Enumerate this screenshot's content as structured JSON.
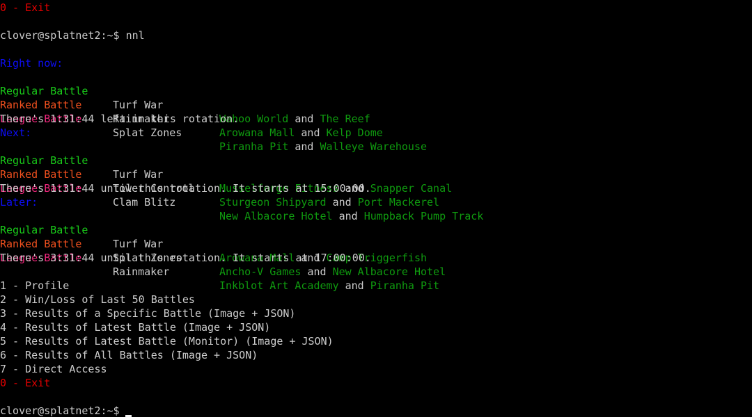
{
  "colors": {
    "background": "#000000",
    "default_text": "#cccccc",
    "exit": "#e70000",
    "section_header": "#0d0df5",
    "regular": "#19cb19",
    "ranked": "#f0501e",
    "league": "#f0287d",
    "stage": "#0f9a0f"
  },
  "top": {
    "exit_line": "0 - Exit",
    "prompt": "clover@splatnet2:~$",
    "command": "nnl"
  },
  "rotations": [
    {
      "header": "Right now:",
      "rows": [
        {
          "type": "Regular Battle",
          "mode": "Turf War",
          "stage1": "Wahoo World",
          "and": "and",
          "stage2": "The Reef"
        },
        {
          "type": "Ranked Battle",
          "mode": "Rainmaker",
          "stage1": "Arowana Mall",
          "and": "and",
          "stage2": "Kelp Dome"
        },
        {
          "type": "League Battle",
          "mode": "Splat Zones",
          "stage1": "Piranha Pit",
          "and": "and",
          "stage2": "Walleye Warehouse"
        }
      ],
      "status": "There's 1:31:44 left in this rotation."
    },
    {
      "header": "Next:",
      "rows": [
        {
          "type": "Regular Battle",
          "mode": "Turf War",
          "stage1": "Musselforge Fitness",
          "and": "and",
          "stage2": "Snapper Canal"
        },
        {
          "type": "Ranked Battle",
          "mode": "Tower Control",
          "stage1": "Sturgeon Shipyard",
          "and": "and",
          "stage2": "Port Mackerel"
        },
        {
          "type": "League Battle",
          "mode": "Clam Blitz",
          "stage1": "New Albacore Hotel",
          "and": "and",
          "stage2": "Humpback Pump Track"
        }
      ],
      "status": "There's 1:31:44 until this rotation. It starts at 15:00:00."
    },
    {
      "header": "Later:",
      "rows": [
        {
          "type": "Regular Battle",
          "mode": "Turf War",
          "stage1": "Arowana Mall",
          "and": "and",
          "stage2": "Camp Triggerfish"
        },
        {
          "type": "Ranked Battle",
          "mode": "Splat Zones",
          "stage1": "Ancho-V Games",
          "and": "and",
          "stage2": "New Albacore Hotel"
        },
        {
          "type": "League Battle",
          "mode": "Rainmaker",
          "stage1": "Inkblot Art Academy",
          "and": "and",
          "stage2": "Piranha Pit"
        }
      ],
      "status": "There's 3:31:44 until this rotation. It starts at 17:00:00."
    }
  ],
  "menu": [
    {
      "label": "1 - Profile"
    },
    {
      "label": "2 - Win/Loss of Last 50 Battles"
    },
    {
      "label": "3 - Results of a Specific Battle (Image + JSON)"
    },
    {
      "label": "4 - Results of Latest Battle (Image + JSON)"
    },
    {
      "label": "5 - Results of Latest Battle (Monitor) (Image + JSON)"
    },
    {
      "label": "6 - Results of All Battles (Image + JSON)"
    },
    {
      "label": "7 - Direct Access"
    },
    {
      "label": "0 - Exit"
    }
  ],
  "bottom": {
    "prompt": "clover@splatnet2:~$"
  }
}
